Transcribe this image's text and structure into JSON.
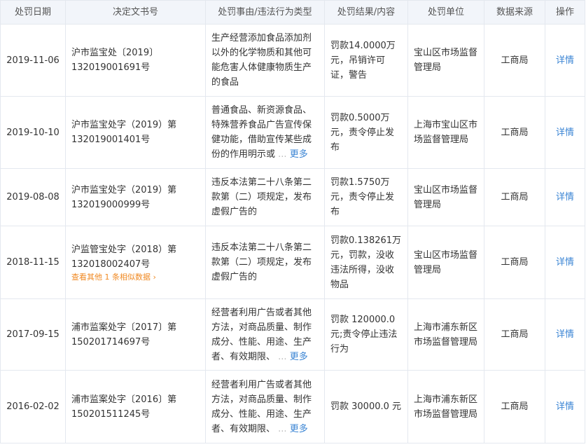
{
  "headers": {
    "date": "处罚日期",
    "doc_no": "决定文书号",
    "reason": "处罚事由/违法行为类型",
    "result": "处罚结果/内容",
    "unit": "处罚单位",
    "source": "数据来源",
    "action": "操作"
  },
  "more_label": "更多",
  "detail_label": "详情",
  "rows": [
    {
      "date": "2019-11-06",
      "doc_no": "沪市监宝处〔2019〕132019001691号",
      "reason": "生产经营添加食品添加剂以外的化学物质和其他可能危害人体健康物质生产的食品",
      "result": "罚款14.0000万元，吊销许可证，警告",
      "unit": "宝山区市场监督管理局",
      "source": "工商局"
    },
    {
      "date": "2019-10-10",
      "doc_no": "沪市监宝处字（2019）第132019001401号",
      "reason": "普通食品、新资源食品、特殊营养食品广告宣传保健功能，借助宣传某些成份的作用明示或",
      "result": "罚款0.5000万元，责令停止发布",
      "unit": "上海市宝山区市场监督管理局",
      "source": "工商局"
    },
    {
      "date": "2019-08-08",
      "doc_no": "沪市监宝处字（2019）第132019000999号",
      "reason": "违反本法第二十八条第二款第（二）项规定，发布虚假广告的",
      "result": "罚款1.5750万元，责令停止发布",
      "unit": "宝山区市场监督管理局",
      "source": "工商局"
    },
    {
      "date": "2018-11-15",
      "doc_no": "沪监管宝处字（2018）第132018002407号",
      "similar": "查看其他 1 条相似数据",
      "reason": "违反本法第二十八条第二款第（二）项规定，发布虚假广告的",
      "result": "罚款0.138261万元，罚款，没收违法所得，没收物品",
      "unit": "宝山区市场监督管理局",
      "source": "工商局"
    },
    {
      "date": "2017-09-15",
      "doc_no": "浦市监案处字〔2017〕第150201714697号",
      "reason": "经营者利用广告或者其他方法，对商品质量、制作成分、性能、用途、生产者、有效期限、",
      "result": "罚款 120000.0元;责令停止违法行为",
      "unit": "上海市浦东新区市场监督管理局",
      "source": "工商局"
    },
    {
      "date": "2016-02-02",
      "doc_no": "浦市监案处字〔2016〕第150201511245号",
      "reason": "经营者利用广告或者其他方法，对商品质量、制作成分、性能、用途、生产者、有效期限、",
      "result": "罚款 30000.0 元",
      "unit": "上海市浦东新区市场监督管理局",
      "source": "工商局"
    }
  ]
}
